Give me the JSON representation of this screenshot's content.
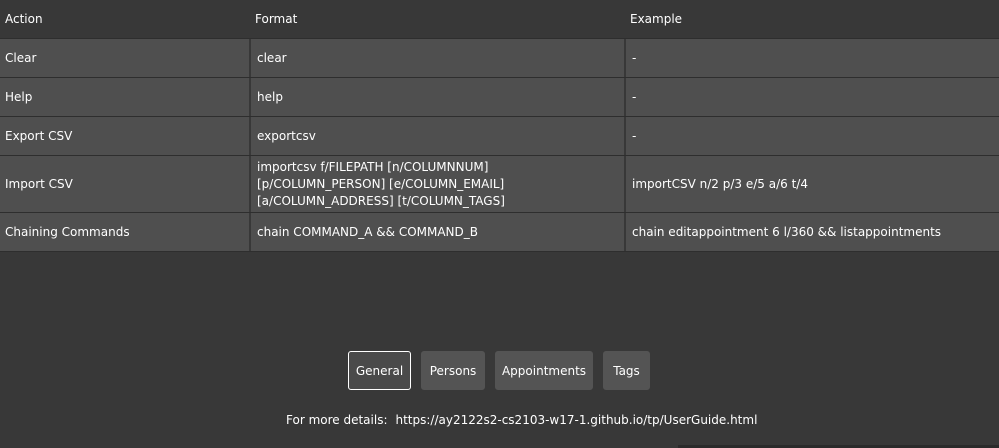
{
  "table": {
    "headers": {
      "action": "Action",
      "format": "Format",
      "example": "Example"
    },
    "rows": [
      {
        "action": "Clear",
        "format": "clear",
        "example": "-"
      },
      {
        "action": "Help",
        "format": "help",
        "example": "-"
      },
      {
        "action": "Export CSV",
        "format": "exportcsv",
        "example": "-"
      },
      {
        "action": "Import CSV",
        "format": "importcsv f/FILEPATH [n/COLUMNNUM] [p/COLUMN_PERSON] [e/COLUMN_EMAIL] [a/COLUMN_ADDRESS] [t/COLUMN_TAGS]",
        "example": "importCSV n/2 p/3 e/5 a/6 t/4"
      },
      {
        "action": "Chaining Commands",
        "format": "chain COMMAND_A && COMMAND_B",
        "example": "chain editappointment 6 l/360 && listappointments"
      }
    ]
  },
  "tabs": [
    {
      "label": "General",
      "active": true
    },
    {
      "label": "Persons",
      "active": false
    },
    {
      "label": "Appointments",
      "active": false
    },
    {
      "label": "Tags",
      "active": false
    }
  ],
  "footer": {
    "label": "For more details:",
    "url": "https://ay2122s2-cs2103-w17-1.github.io/tp/UserGuide.html"
  }
}
